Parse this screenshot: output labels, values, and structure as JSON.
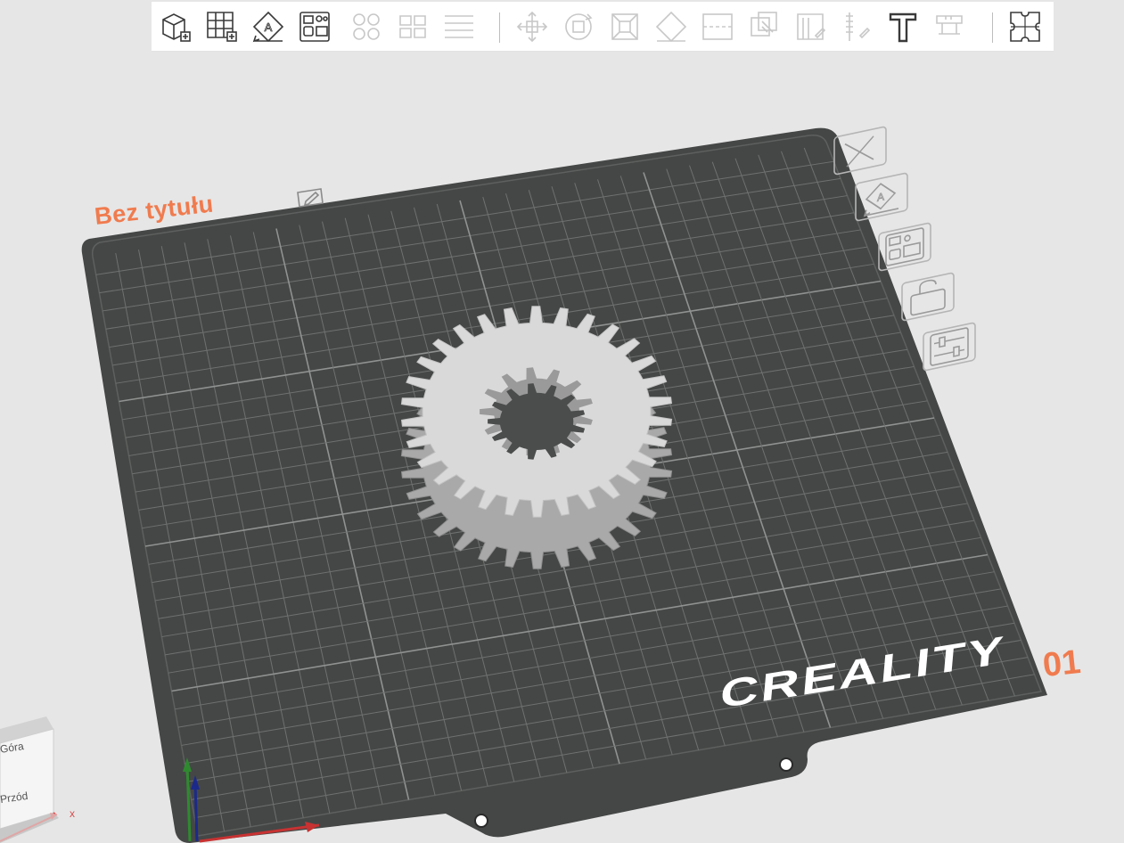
{
  "toolbar": {
    "buttons": [
      {
        "name": "add-model-button",
        "icon": "cube-plus-icon",
        "enabled": true
      },
      {
        "name": "add-plate-button",
        "icon": "grid-plus-icon",
        "enabled": true
      },
      {
        "name": "auto-orient-button",
        "icon": "orient-icon",
        "enabled": true
      },
      {
        "name": "arrange-button",
        "icon": "arrange-icon",
        "enabled": true
      },
      {
        "name": "split-objects-button",
        "icon": "split-objects-icon",
        "enabled": false
      },
      {
        "name": "split-parts-button",
        "icon": "split-parts-icon",
        "enabled": false
      },
      {
        "name": "variable-layer-button",
        "icon": "layers-icon",
        "enabled": false
      },
      {
        "name": "move-button",
        "icon": "move-icon",
        "enabled": false
      },
      {
        "name": "rotate-button",
        "icon": "rotate-icon",
        "enabled": false
      },
      {
        "name": "scale-button",
        "icon": "scale-icon",
        "enabled": false
      },
      {
        "name": "lay-on-face-button",
        "icon": "lay-on-face-icon",
        "enabled": false
      },
      {
        "name": "cut-button",
        "icon": "cut-icon",
        "enabled": false
      },
      {
        "name": "boolean-button",
        "icon": "boolean-icon",
        "enabled": false
      },
      {
        "name": "support-paint-button",
        "icon": "support-paint-icon",
        "enabled": false
      },
      {
        "name": "seam-paint-button",
        "icon": "seam-paint-icon",
        "enabled": false
      },
      {
        "name": "text-button",
        "icon": "text-icon",
        "enabled": true
      },
      {
        "name": "measure-button",
        "icon": "measure-icon",
        "enabled": false
      },
      {
        "name": "assembly-button",
        "icon": "puzzle-icon",
        "enabled": true
      }
    ]
  },
  "plate": {
    "title": "Bez tytułu",
    "number": "01",
    "brand": "CREALITY",
    "accent_color": "#f07b4e",
    "bed_color": "#454746",
    "side_buttons": [
      {
        "name": "remove-plate-button",
        "icon": "close-icon"
      },
      {
        "name": "plate-orient-button",
        "icon": "orient-icon"
      },
      {
        "name": "plate-arrange-button",
        "icon": "arrange-icon"
      },
      {
        "name": "plate-lock-button",
        "icon": "unlock-icon"
      },
      {
        "name": "plate-settings-button",
        "icon": "sliders-icon"
      }
    ]
  },
  "view_cube": {
    "top_label": "Góra",
    "front_label": "Przód",
    "x_axis_label": "x"
  },
  "model": {
    "name": "gear",
    "teeth": 30,
    "inner_teeth": 13,
    "color": "#d9d9d9"
  }
}
